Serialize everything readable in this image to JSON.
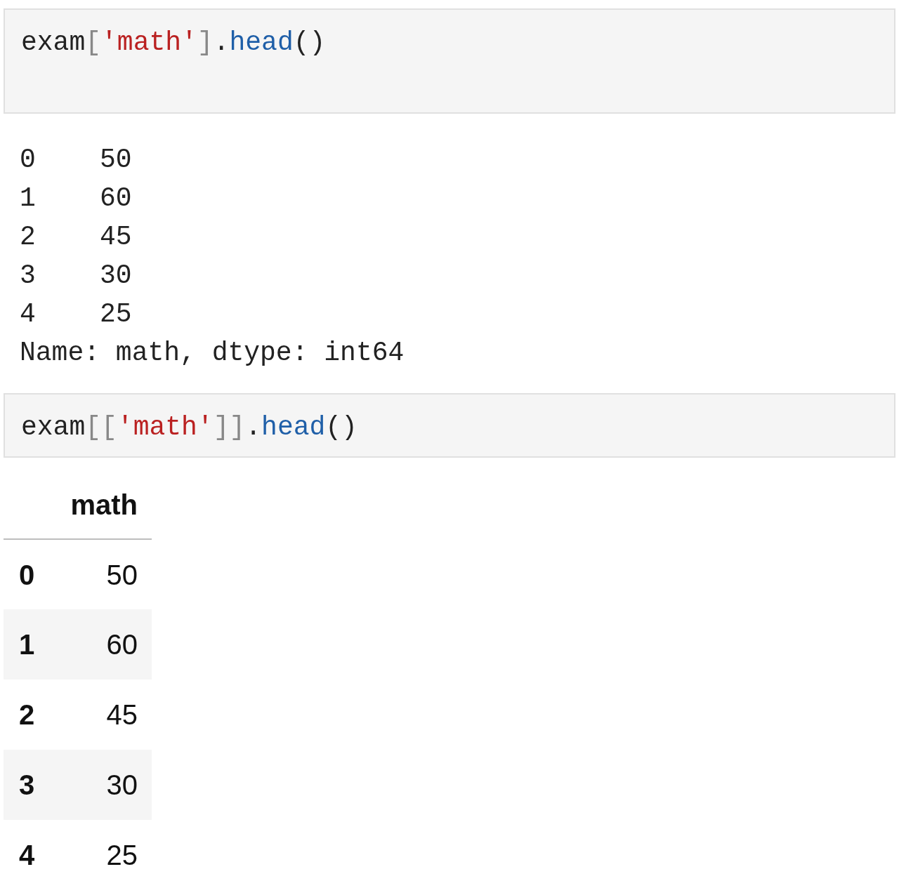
{
  "cells": [
    {
      "kind": "code",
      "tokens": [
        {
          "kind": "name",
          "text": "exam"
        },
        {
          "kind": "punct",
          "text": "["
        },
        {
          "kind": "string",
          "text": "'math'"
        },
        {
          "kind": "punct",
          "text": "]"
        },
        {
          "kind": "name",
          "text": "."
        },
        {
          "kind": "attr",
          "text": "head"
        },
        {
          "kind": "name",
          "text": "()"
        }
      ]
    },
    {
      "kind": "stream",
      "lines": [
        "0    50",
        "1    60",
        "2    45",
        "3    30",
        "4    25",
        "Name: math, dtype: int64"
      ]
    },
    {
      "kind": "code",
      "tokens": [
        {
          "kind": "name",
          "text": "exam"
        },
        {
          "kind": "punct",
          "text": "[["
        },
        {
          "kind": "string",
          "text": "'math'"
        },
        {
          "kind": "punct",
          "text": "]]"
        },
        {
          "kind": "name",
          "text": "."
        },
        {
          "kind": "attr",
          "text": "head"
        },
        {
          "kind": "name",
          "text": "()"
        }
      ]
    },
    {
      "kind": "table",
      "columns": [
        "math"
      ],
      "rows": [
        {
          "index": "0",
          "values": [
            "50"
          ]
        },
        {
          "index": "1",
          "values": [
            "60"
          ]
        },
        {
          "index": "2",
          "values": [
            "45"
          ]
        },
        {
          "index": "3",
          "values": [
            "30"
          ]
        },
        {
          "index": "4",
          "values": [
            "25"
          ]
        }
      ]
    }
  ]
}
